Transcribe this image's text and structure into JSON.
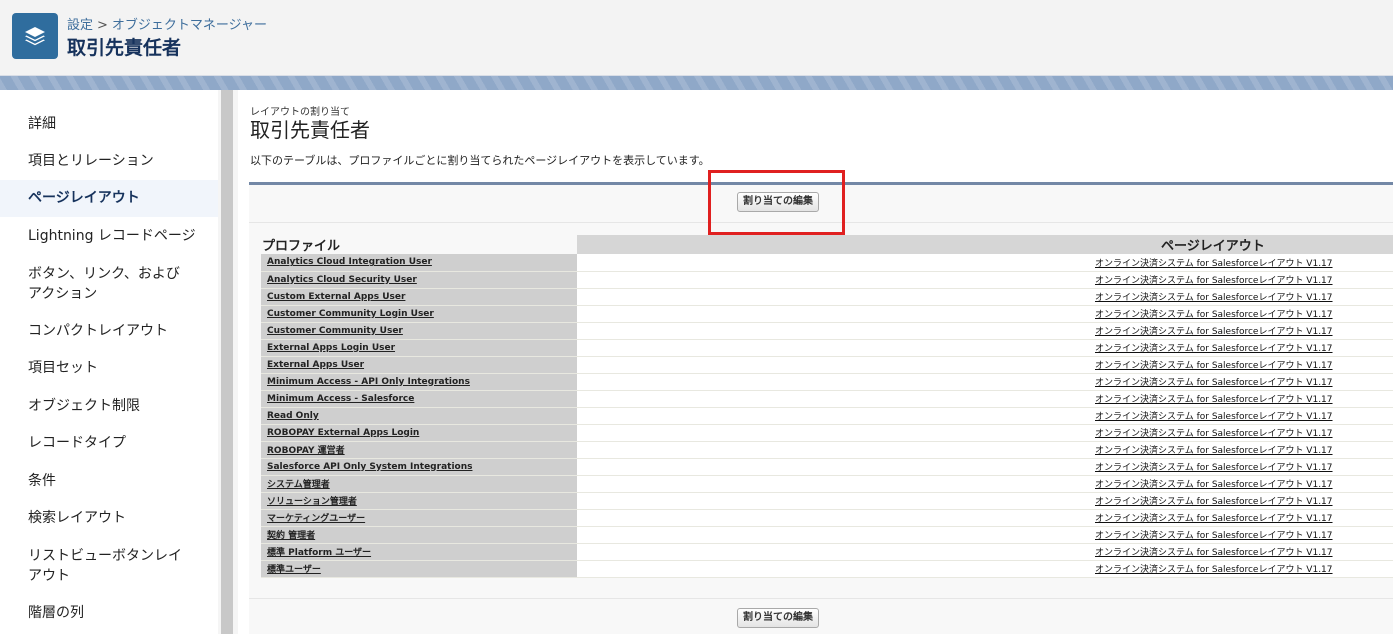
{
  "header": {
    "breadcrumb": [
      "設定",
      "オブジェクトマネージャー"
    ],
    "title": "取引先責任者",
    "app_icon": "layers-icon"
  },
  "sidebar": {
    "items": [
      {
        "label": "詳細",
        "active": false
      },
      {
        "label": "項目とリレーション",
        "active": false
      },
      {
        "label": "ページレイアウト",
        "active": true
      },
      {
        "label": "Lightning レコードページ",
        "active": false
      },
      {
        "label": "ボタン、リンク、およびアクション",
        "active": false
      },
      {
        "label": "コンパクトレイアウト",
        "active": false
      },
      {
        "label": "項目セット",
        "active": false
      },
      {
        "label": "オブジェクト制限",
        "active": false
      },
      {
        "label": "レコードタイプ",
        "active": false
      },
      {
        "label": "条件",
        "active": false
      },
      {
        "label": "検索レイアウト",
        "active": false
      },
      {
        "label": "リストビューボタンレイアウト",
        "active": false
      },
      {
        "label": "階層の列",
        "active": false
      }
    ]
  },
  "main": {
    "section_label": "レイアウトの割り当て",
    "title": "取引先責任者",
    "description": "以下のテーブルは、プロファイルごとに割り当てられたページレイアウトを表示しています。",
    "edit_button": "割り当ての編集",
    "table": {
      "headers": [
        "プロファイル",
        "ページレイアウト"
      ],
      "rows": [
        {
          "profile": "Analytics Cloud Integration User",
          "layout": "オンライン決済システム for Salesforceレイアウト V1.17"
        },
        {
          "profile": "Analytics Cloud Security User",
          "layout": "オンライン決済システム for Salesforceレイアウト V1.17"
        },
        {
          "profile": "Custom External Apps User",
          "layout": "オンライン決済システム for Salesforceレイアウト V1.17"
        },
        {
          "profile": "Customer Community Login User",
          "layout": "オンライン決済システム for Salesforceレイアウト V1.17"
        },
        {
          "profile": "Customer Community User",
          "layout": "オンライン決済システム for Salesforceレイアウト V1.17"
        },
        {
          "profile": "External Apps Login User",
          "layout": "オンライン決済システム for Salesforceレイアウト V1.17"
        },
        {
          "profile": "External Apps User",
          "layout": "オンライン決済システム for Salesforceレイアウト V1.17"
        },
        {
          "profile": "Minimum Access - API Only Integrations",
          "layout": "オンライン決済システム for Salesforceレイアウト V1.17"
        },
        {
          "profile": "Minimum Access - Salesforce",
          "layout": "オンライン決済システム for Salesforceレイアウト V1.17"
        },
        {
          "profile": "Read Only",
          "layout": "オンライン決済システム for Salesforceレイアウト V1.17"
        },
        {
          "profile": "ROBOPAY External Apps Login",
          "layout": "オンライン決済システム for Salesforceレイアウト V1.17"
        },
        {
          "profile": "ROBOPAY 運営者",
          "layout": "オンライン決済システム for Salesforceレイアウト V1.17"
        },
        {
          "profile": "Salesforce API Only System Integrations",
          "layout": "オンライン決済システム for Salesforceレイアウト V1.17"
        },
        {
          "profile": "システム管理者",
          "layout": "オンライン決済システム for Salesforceレイアウト V1.17"
        },
        {
          "profile": "ソリューション管理者",
          "layout": "オンライン決済システム for Salesforceレイアウト V1.17"
        },
        {
          "profile": "マーケティングユーザー",
          "layout": "オンライン決済システム for Salesforceレイアウト V1.17"
        },
        {
          "profile": "契約 管理者",
          "layout": "オンライン決済システム for Salesforceレイアウト V1.17"
        },
        {
          "profile": "標準 Platform ユーザー",
          "layout": "オンライン決済システム for Salesforceレイアウト V1.17"
        },
        {
          "profile": "標準ユーザー",
          "layout": "オンライン決済システム for Salesforceレイアウト V1.17"
        }
      ]
    }
  },
  "colors": {
    "header_bg": "#f3f3f3",
    "band": "#8fa8c8",
    "app_icon_bg": "#2f6d9e",
    "highlight_box": "#e02020",
    "profile_cell_bg": "#cfcfcf"
  }
}
